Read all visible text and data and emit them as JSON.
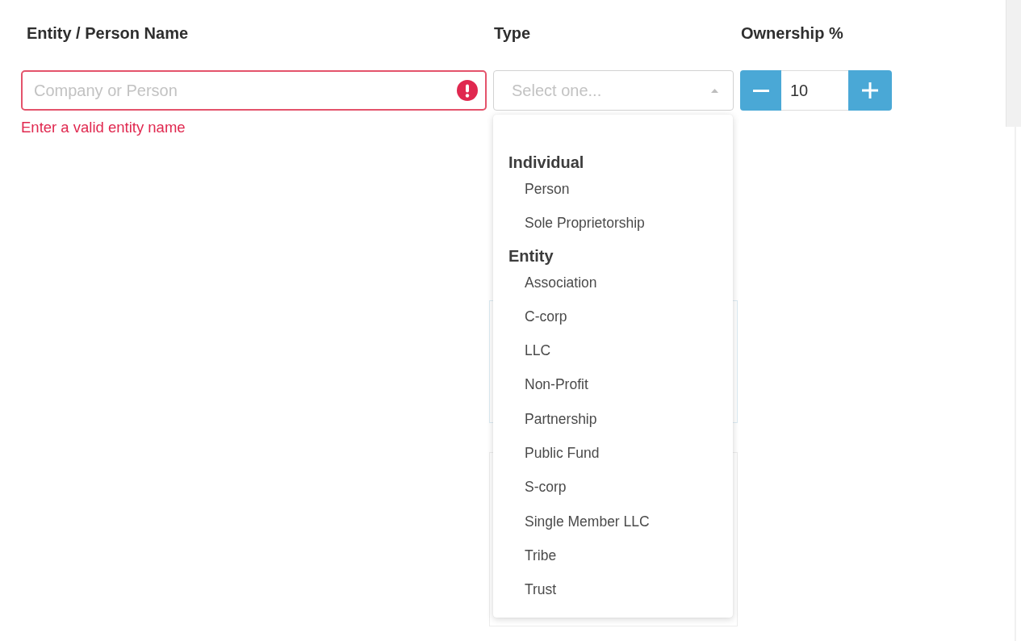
{
  "columns": [
    {
      "label": "Entity / Person Name"
    },
    {
      "label": "Type"
    },
    {
      "label": "Ownership %"
    }
  ],
  "name_field": {
    "placeholder": "Company or Person",
    "invalid": true,
    "error": "Enter a valid entity name"
  },
  "type_select": {
    "placeholder": "Select one...",
    "expanded": true,
    "groups": [
      {
        "label": "Individual",
        "options": [
          {
            "label": "Person",
            "selected": false
          },
          {
            "label": "Sole Proprietorship",
            "selected": false
          }
        ]
      },
      {
        "label": "Entity",
        "options": [
          {
            "label": "Association",
            "selected": false
          },
          {
            "label": "C-corp",
            "selected": false
          },
          {
            "label": "LLC",
            "selected": false
          },
          {
            "label": "Non-Profit",
            "selected": false
          },
          {
            "label": "Partnership",
            "selected": false
          },
          {
            "label": "Public Fund",
            "selected": false
          },
          {
            "label": "S-corp",
            "selected": false
          },
          {
            "label": "Single Member LLC",
            "selected": false
          },
          {
            "label": "Tribe",
            "selected": false
          },
          {
            "label": "Trust",
            "selected": false
          }
        ]
      }
    ]
  },
  "ownership": {
    "value": "10"
  }
}
